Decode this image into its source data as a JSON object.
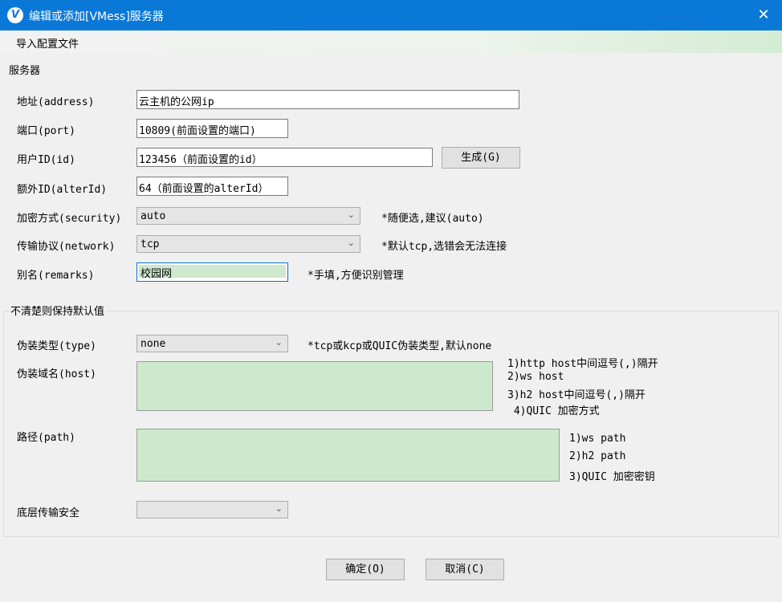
{
  "window": {
    "title": "编辑或添加[VMess]服务器",
    "app_icon": "V",
    "close_glyph": "✕"
  },
  "menu": {
    "import_label": "导入配置文件"
  },
  "server": {
    "group_label": "服务器",
    "address": {
      "label": "地址(address)",
      "value": "云主机的公网ip"
    },
    "port": {
      "label": "端口(port)",
      "value": "10809(前面设置的端口)"
    },
    "id": {
      "label": "用户ID(id)",
      "value": "123456（前面设置的id）",
      "generate_label": "生成(G)"
    },
    "alter_id": {
      "label": "额外ID(alterId)",
      "value": "64（前面设置的alterId）"
    },
    "security": {
      "label": "加密方式(security)",
      "value": "auto",
      "hint": "*随便选,建议(auto)"
    },
    "network": {
      "label": "传输协议(network)",
      "value": "tcp",
      "hint": "*默认tcp,选错会无法连接"
    },
    "remarks": {
      "label": "别名(remarks)",
      "value": "校园网",
      "hint": "*手填,方便识别管理"
    }
  },
  "advanced": {
    "group_label": "不清楚则保持默认值",
    "type": {
      "label": "伪装类型(type)",
      "value": "none",
      "hint": "*tcp或kcp或QUIC伪装类型,默认none"
    },
    "host": {
      "label": "伪装域名(host)",
      "hints": [
        "1)http host中间逗号(,)隔开",
        "2)ws host",
        "3)h2 host中间逗号(,)隔开",
        " 4)QUIC 加密方式"
      ]
    },
    "path": {
      "label": "路径(path)",
      "hints": [
        "1)ws path",
        "2)h2 path",
        "3)QUIC 加密密钥"
      ]
    },
    "tls": {
      "label": "底层传输安全",
      "value": ""
    }
  },
  "footer": {
    "ok_label": "确定(O)",
    "cancel_label": "取消(C)"
  },
  "colors": {
    "titlebar": "#0a78d7",
    "input_fill": "#cde9cd",
    "focus_border": "#0078d7"
  }
}
